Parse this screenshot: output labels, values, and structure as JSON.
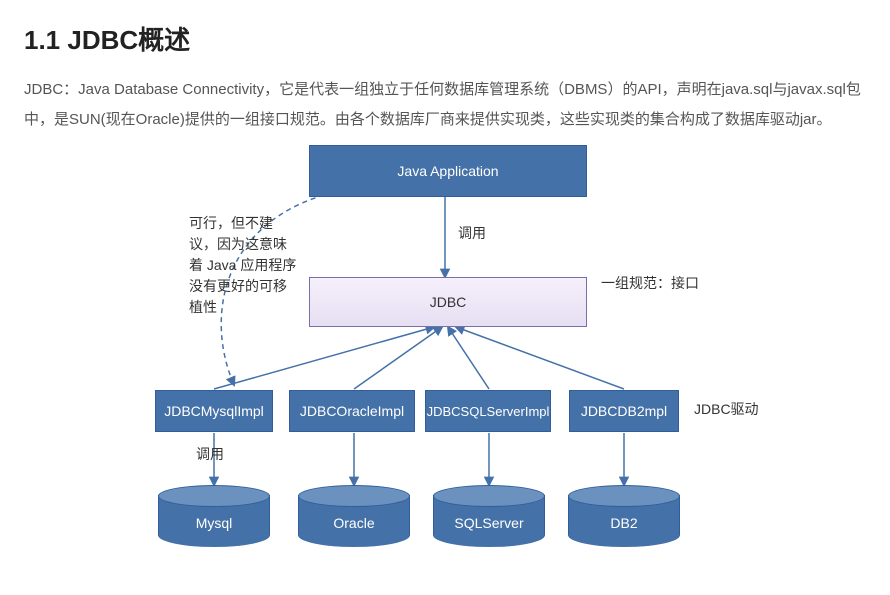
{
  "heading": "1.1 JDBC概述",
  "paragraph": "JDBC：Java Database Connectivity，它是代表一组独立于任何数据库管理系统（DBMS）的API，声明在java.sql与javax.sql包中，是SUN(现在Oracle)提供的一组接口规范。由各个数据库厂商来提供实现类，这些实现类的集合构成了数据库驱动jar。",
  "diagram": {
    "java_app": "Java Application",
    "call_label_1": "调用",
    "note_left": "可行，但不建议，因为这意味着 Java 应用程序没有更好的可移植性",
    "jdbc": "JDBC",
    "note_right": "一组规范：接口",
    "impls": [
      "JDBCMysqlImpl",
      "JDBCOracleImpl",
      "JDBCSQLServerImpl",
      "JDBCDB2mpl"
    ],
    "driver_label": "JDBC驱动",
    "call_label_2": "调用",
    "dbs": [
      "Mysql",
      "Oracle",
      "SQLServer",
      "DB2"
    ]
  }
}
